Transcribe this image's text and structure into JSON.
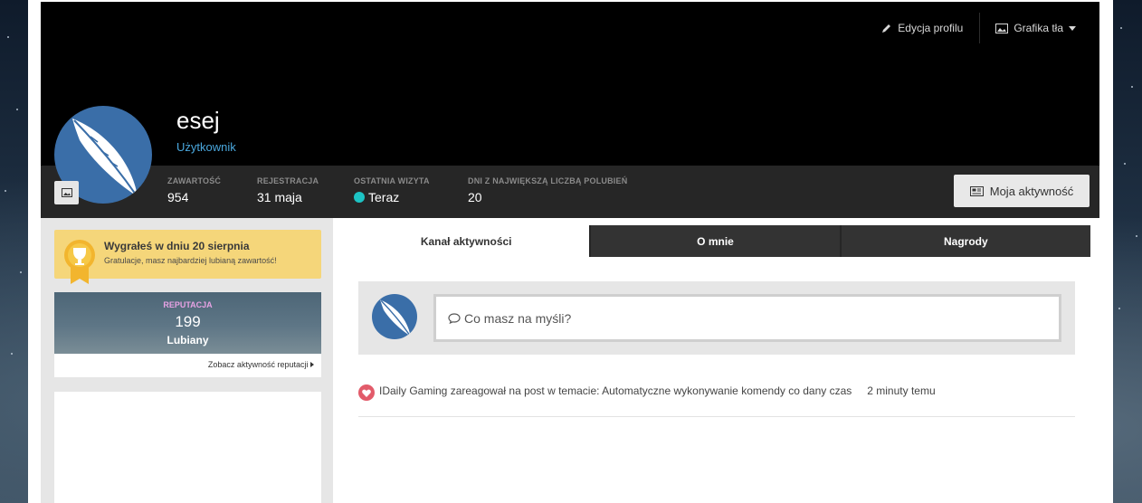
{
  "cover": {
    "edit_profile_label": "Edycja profilu",
    "cover_photo_label": "Grafika tła"
  },
  "profile": {
    "username": "esej",
    "group": "Użytkownik"
  },
  "stats": [
    {
      "label": "ZAWARTOŚĆ",
      "value": "954"
    },
    {
      "label": "REJESTRACJA",
      "value": "31 maja"
    },
    {
      "label": "OSTATNIA WIZYTA",
      "value": "Teraz"
    },
    {
      "label": "DNI Z NAJWIĘKSZĄ LICZBĄ POLUBIEŃ",
      "value": "20"
    }
  ],
  "activity_button_label": "Moja aktywność",
  "award": {
    "title": "Wygrałeś w dniu 20 sierpnia",
    "subtitle": "Gratulacje, masz najbardziej lubianą zawartość!"
  },
  "reputation": {
    "label": "REPUTACJA",
    "value": "199",
    "rank": "Lubiany",
    "link": "Zobacz aktywność reputacji"
  },
  "tabs": [
    {
      "label": "Kanał aktywności",
      "active": true
    },
    {
      "label": "O mnie",
      "active": false
    },
    {
      "label": "Nagrody",
      "active": false
    }
  ],
  "composer": {
    "placeholder": "Co masz na myśli?"
  },
  "stream": [
    {
      "text": "IDaily Gaming zareagował na post w temacie: Automatyczne wykonywanie komendy co dany czas",
      "time": "2 minuty temu"
    }
  ],
  "colors": {
    "accent": "#4aa7dd",
    "online": "#1dc3c4",
    "award_bg": "#f5d67a",
    "reputation_label": "#e7a2e4",
    "heart": "#e25b6a"
  }
}
